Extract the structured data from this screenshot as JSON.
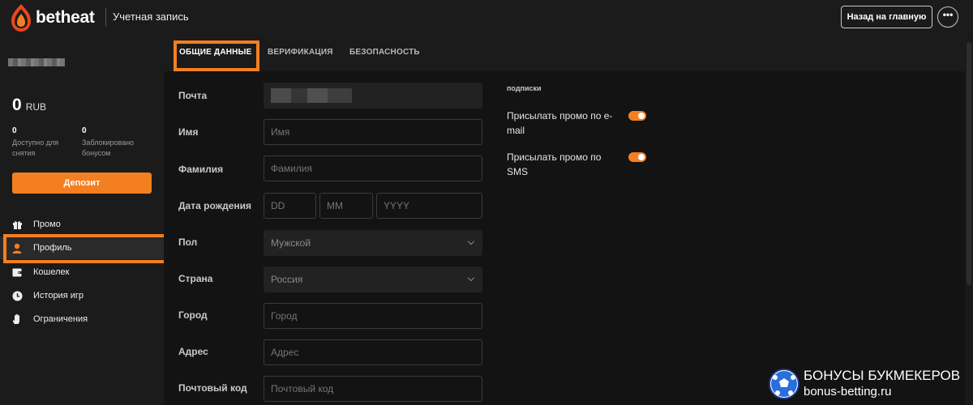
{
  "header": {
    "brand": "betheat",
    "section_title": "Учетная запись",
    "back_button": "Назад на главную",
    "more_button": "•••"
  },
  "sidebar": {
    "balance": {
      "amount": "0",
      "currency": "RUB"
    },
    "stats": [
      {
        "value": "0",
        "label": "Доступно для снятия"
      },
      {
        "value": "0",
        "label": "Заблокировано бонусом"
      }
    ],
    "deposit_button": "Депозит",
    "nav": [
      {
        "label": "Промо",
        "icon": "gift-icon"
      },
      {
        "label": "Профиль",
        "icon": "user-icon",
        "active": true
      },
      {
        "label": "Кошелек",
        "icon": "wallet-icon"
      },
      {
        "label": "История игр",
        "icon": "clock-icon"
      },
      {
        "label": "Ограничения",
        "icon": "hand-icon"
      }
    ]
  },
  "tabs": [
    {
      "label": "ОБЩИЕ ДАННЫЕ",
      "active": true
    },
    {
      "label": "ВЕРИФИКАЦИЯ"
    },
    {
      "label": "БЕЗОПАСНОСТЬ"
    }
  ],
  "form": {
    "email": {
      "label": "Почта"
    },
    "first_name": {
      "label": "Имя",
      "placeholder": "Имя"
    },
    "last_name": {
      "label": "Фамилия",
      "placeholder": "Фамилия"
    },
    "birthdate": {
      "label": "Дата рождения",
      "day": "DD",
      "month": "MM",
      "year": "YYYY"
    },
    "gender": {
      "label": "Пол",
      "value": "Мужской"
    },
    "country": {
      "label": "Страна",
      "value": "Россия"
    },
    "city": {
      "label": "Город",
      "placeholder": "Город"
    },
    "address": {
      "label": "Адрес",
      "placeholder": "Адрес"
    },
    "postal_code": {
      "label": "Почтовый код",
      "placeholder": "Почтовый код"
    }
  },
  "subscriptions": {
    "title": "подписки",
    "items": [
      {
        "label": "Присылать промо по e-mail",
        "enabled": true
      },
      {
        "label": "Присылать промо по SMS",
        "enabled": true
      }
    ]
  },
  "watermark": {
    "line1": "БОНУСЫ БУКМЕКЕРОВ",
    "line2": "bonus-betting.ru"
  },
  "colors": {
    "accent": "#f47f20",
    "background": "#131313",
    "panel": "#1b1b1b"
  }
}
